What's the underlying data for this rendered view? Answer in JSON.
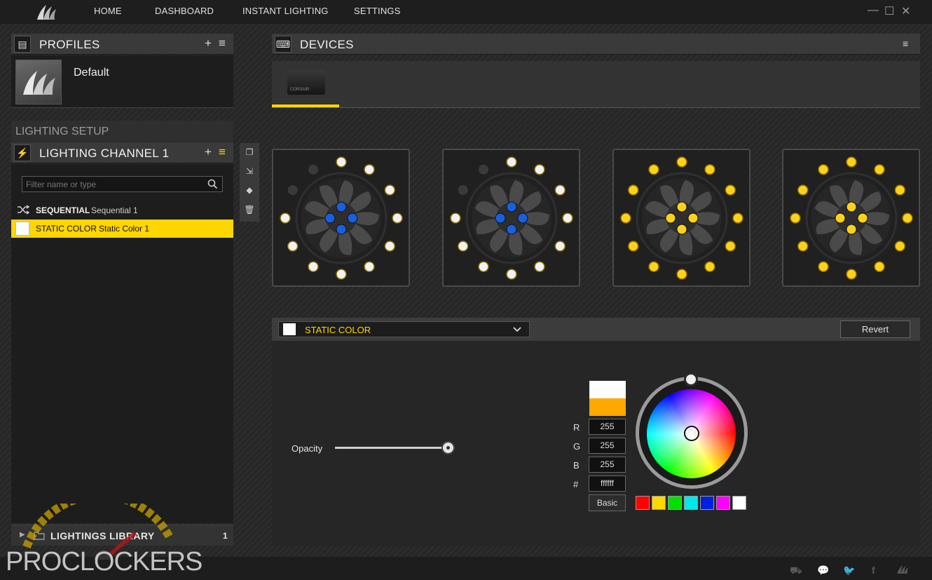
{
  "topnav": {
    "items": [
      "HOME",
      "DASHBOARD",
      "INSTANT LIGHTING",
      "SETTINGS"
    ],
    "window_controls": {
      "minimize": "—",
      "maximize": "☐",
      "close": "✕"
    }
  },
  "profiles": {
    "title": "PROFILES",
    "add": "+",
    "menu": "≡",
    "items": [
      {
        "name": "Default"
      }
    ]
  },
  "lighting_setup": {
    "section_title": "LIGHTING SETUP",
    "channel_title": "LIGHTING CHANNEL 1",
    "add": "+",
    "menu": "≡",
    "filter_placeholder": "Filter name or type",
    "effects": [
      {
        "type": "SEQUENTIAL",
        "name": "Sequential 1",
        "selected": false
      },
      {
        "type": "STATIC COLOR",
        "name": "Static Color 1",
        "selected": true
      }
    ]
  },
  "library": {
    "title": "LIGHTINGS LIBRARY",
    "count": "1"
  },
  "devices": {
    "title": "DEVICES",
    "menu": "≡",
    "selected_device_label": "CORSAIR"
  },
  "fans": [
    {
      "ring": [
        "white",
        "white",
        "white",
        "white",
        "white",
        "white",
        "white",
        "white",
        "white",
        "white",
        "off",
        "off"
      ],
      "center": "blue"
    },
    {
      "ring": [
        "white",
        "white",
        "white",
        "white",
        "white",
        "white",
        "white",
        "white",
        "white",
        "white",
        "off",
        "off"
      ],
      "center": "blue"
    },
    {
      "ring": [
        "yellow",
        "yellow",
        "yellow",
        "yellow",
        "yellow",
        "yellow",
        "yellow",
        "yellow",
        "yellow",
        "yellow",
        "yellow",
        "yellow"
      ],
      "center": "yellow"
    },
    {
      "ring": [
        "yellow",
        "yellow",
        "yellow",
        "yellow",
        "yellow",
        "yellow",
        "yellow",
        "yellow",
        "yellow",
        "yellow",
        "yellow",
        "yellow"
      ],
      "center": "yellow"
    }
  ],
  "led_colors": {
    "white": "#f2f2f2",
    "blue": "#1a5fe0",
    "yellow": "#ffd21a",
    "off": "#3a3a3a",
    "accent": "#ffd600"
  },
  "editor": {
    "effect_type": "STATIC COLOR",
    "revert_label": "Revert",
    "opacity_label": "Opacity",
    "opacity_value": 1.0,
    "r_label": "R",
    "g_label": "G",
    "b_label": "B",
    "hex_label": "#",
    "r": "255",
    "g": "255",
    "b": "255",
    "hex": "ffffff",
    "basic_label": "Basic",
    "preview_new": "#ffffff",
    "preview_old": "#ffa800",
    "swatches": [
      "#ff0000",
      "#ffd800",
      "#00e000",
      "#00e8e8",
      "#0020e0",
      "#ff00ff",
      "#ffffff"
    ]
  },
  "watermark": "PROCLOCKERS"
}
